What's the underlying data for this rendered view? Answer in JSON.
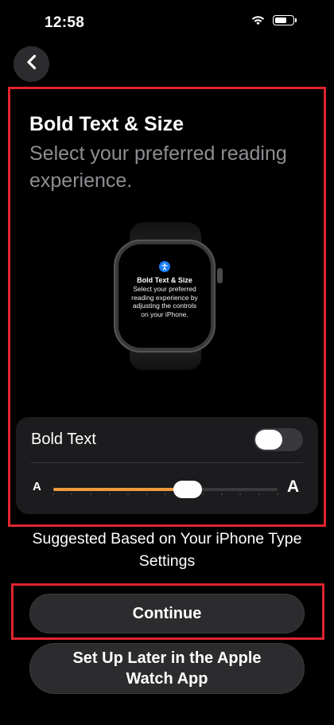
{
  "status_bar": {
    "time": "12:58",
    "wifi_icon": "wifi-icon",
    "battery_icon": "battery-icon",
    "battery_level": 0.7
  },
  "nav": {
    "back_icon": "chevron-left-icon"
  },
  "header": {
    "title": "Bold Text & Size",
    "subtitle": "Select your preferred reading experience."
  },
  "watch_preview": {
    "icon": "accessibility-icon",
    "icon_color": "#1a7cf5",
    "title": "Bold Text & Size",
    "body": "Select your preferred reading experience by adjusting the controls on your iPhone."
  },
  "controls": {
    "bold_text_label": "Bold Text",
    "bold_text_enabled": false,
    "size_small_label": "A",
    "size_large_label": "A",
    "slider_value": 0.6,
    "slider_steps": 13,
    "accent_color": "#ef9a3e"
  },
  "suggestion": {
    "text": "Suggested Based on Your iPhone Type Settings"
  },
  "actions": {
    "continue_label": "Continue",
    "setup_later_label": "Set Up Later in the Apple Watch App"
  },
  "highlight_color": "#e0242e"
}
